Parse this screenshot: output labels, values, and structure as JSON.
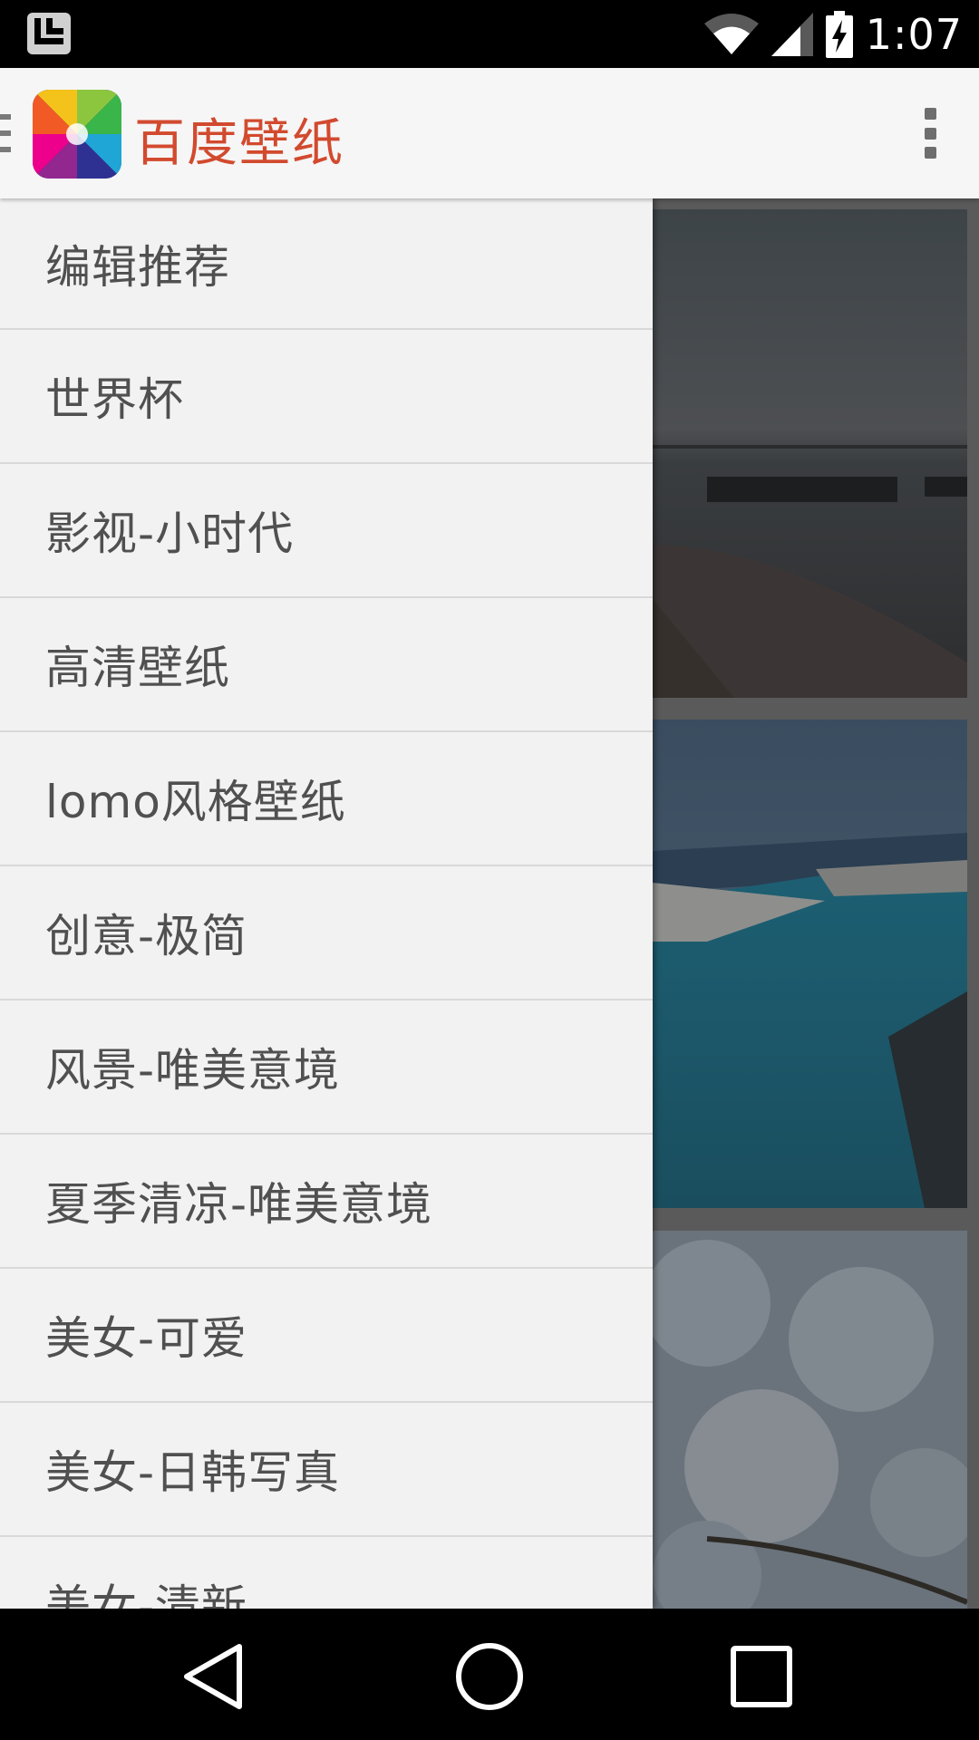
{
  "status_bar": {
    "time": "1:07",
    "icons": [
      "notification-icon",
      "wifi-icon",
      "signal-icon",
      "battery-charging-icon"
    ]
  },
  "app_bar": {
    "title": "百度壁纸",
    "menu_icon": "hamburger-icon",
    "overflow_icon": "overflow-menu-icon",
    "title_color": "#d24a2e"
  },
  "drawer": {
    "items": [
      {
        "label": "编辑推荐"
      },
      {
        "label": "世界杯"
      },
      {
        "label": "影视-小时代"
      },
      {
        "label": "高清壁纸"
      },
      {
        "label": "lomo风格壁纸"
      },
      {
        "label": "创意-极简"
      },
      {
        "label": "风景-唯美意境"
      },
      {
        "label": "夏季清凉-唯美意境"
      },
      {
        "label": "美女-可爱"
      },
      {
        "label": "美女-日韩写真"
      },
      {
        "label": "美女-清新"
      }
    ]
  },
  "content": {
    "wallpapers": [
      {
        "subject": "lake-pier-dusk"
      },
      {
        "subject": "infinity-pool-sea"
      },
      {
        "subject": "white-blossoms"
      }
    ]
  },
  "nav_bar": {
    "icons": [
      "back-icon",
      "home-icon",
      "recent-apps-icon"
    ]
  }
}
